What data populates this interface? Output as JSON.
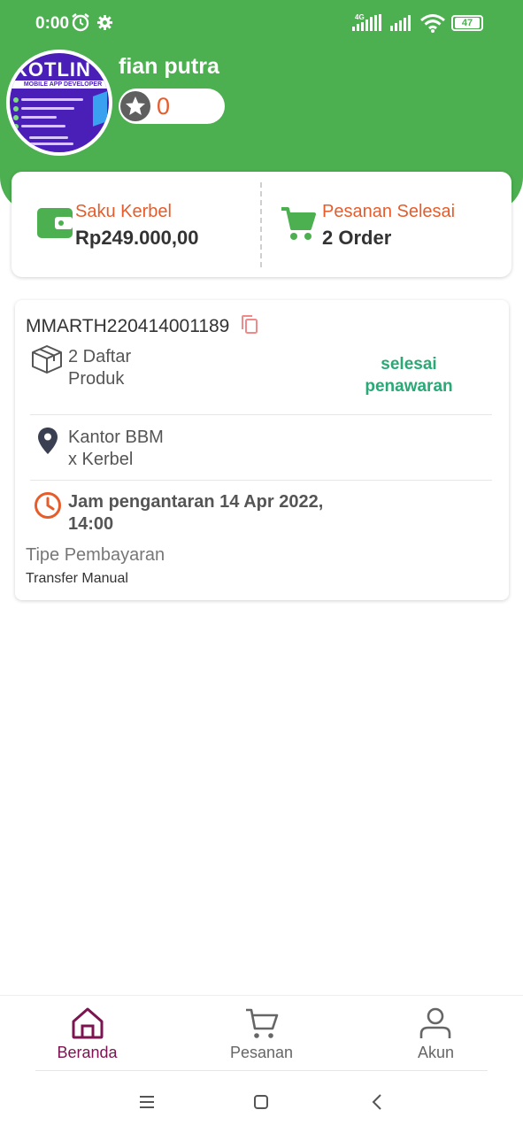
{
  "status_bar": {
    "time": "0:00",
    "network": "4G",
    "battery": "47"
  },
  "profile": {
    "name": "fian putra",
    "points": "0",
    "avatar_title": "KOTLIN",
    "avatar_subtitle": "MOBILE APP DEVELOPER"
  },
  "summary": {
    "wallet_label": "Saku Kerbel",
    "wallet_value": "Rp249.000,00",
    "orders_label": "Pesanan Selesai",
    "orders_value": "2 Order"
  },
  "order": {
    "id": "MMARTH220414001189",
    "products_line1": "2 Daftar",
    "products_line2": "Produk",
    "status_line1": "selesai",
    "status_line2": "penawaran",
    "location_line1": "Kantor BBM",
    "location_line2": "x Kerbel",
    "delivery_line1": "Jam pengantaran 14 Apr 2022,",
    "delivery_line2": "14:00",
    "payment_label": "Tipe Pembayaran",
    "payment_value": "Transfer Manual"
  },
  "bottom_nav": {
    "items": [
      {
        "label": "Beranda",
        "icon": "home-icon",
        "active": true
      },
      {
        "label": "Pesanan",
        "icon": "cart-icon",
        "active": false
      },
      {
        "label": "Akun",
        "icon": "user-icon",
        "active": false
      }
    ]
  },
  "colors": {
    "brand_green": "#4caf50",
    "accent_orange": "#e65c2b",
    "status_green": "#2aa876",
    "active_nav": "#7b1450"
  }
}
